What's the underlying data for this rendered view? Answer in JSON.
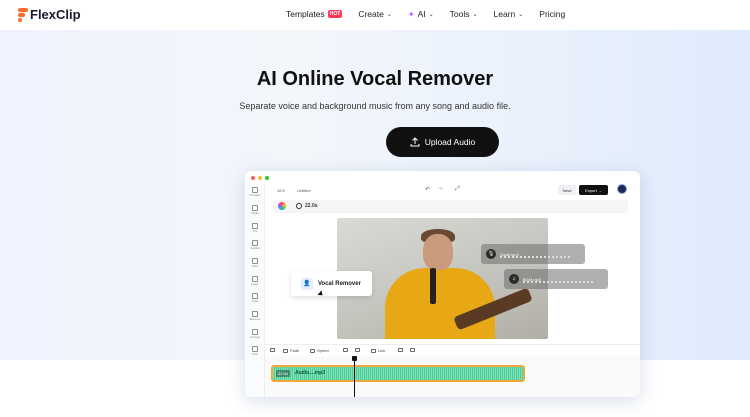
{
  "nav": {
    "logo": "FlexClip",
    "items": [
      {
        "label": "Templates",
        "badge": "HOT"
      },
      {
        "label": "Create"
      },
      {
        "label": "AI"
      },
      {
        "label": "Tools"
      },
      {
        "label": "Learn"
      },
      {
        "label": "Pricing"
      }
    ]
  },
  "hero": {
    "title": "AI Online Vocal Remover",
    "subtitle": "Separate voice and background music from any song and audio file.",
    "upload_label": "Upload Audio"
  },
  "editor": {
    "ratio": "16:9",
    "project_name": "Untitled",
    "save_label": "Save",
    "export_label": "Export",
    "duration": "22.0s",
    "sidebar": [
      "Templates",
      "Media",
      "Text",
      "Subtitles",
      "Video",
      "Image",
      "Audio",
      "Elements",
      "Overlays",
      "Tools"
    ],
    "vocal_remover_label": "Vocal Remover",
    "tracks": [
      {
        "name": "Vocal.mp3"
      },
      {
        "name": "BGM.mp3"
      }
    ],
    "bottom_tools": {
      "fade": "Fade",
      "speed": "Speed",
      "link": "Link"
    },
    "clip": {
      "duration": "22.0s",
      "name": "Audio....mp3"
    }
  },
  "colors": {
    "accent": "#ff6a2a",
    "button": "#111111",
    "clip_border": "#f0a83a",
    "waveform": "#4ccf97"
  }
}
